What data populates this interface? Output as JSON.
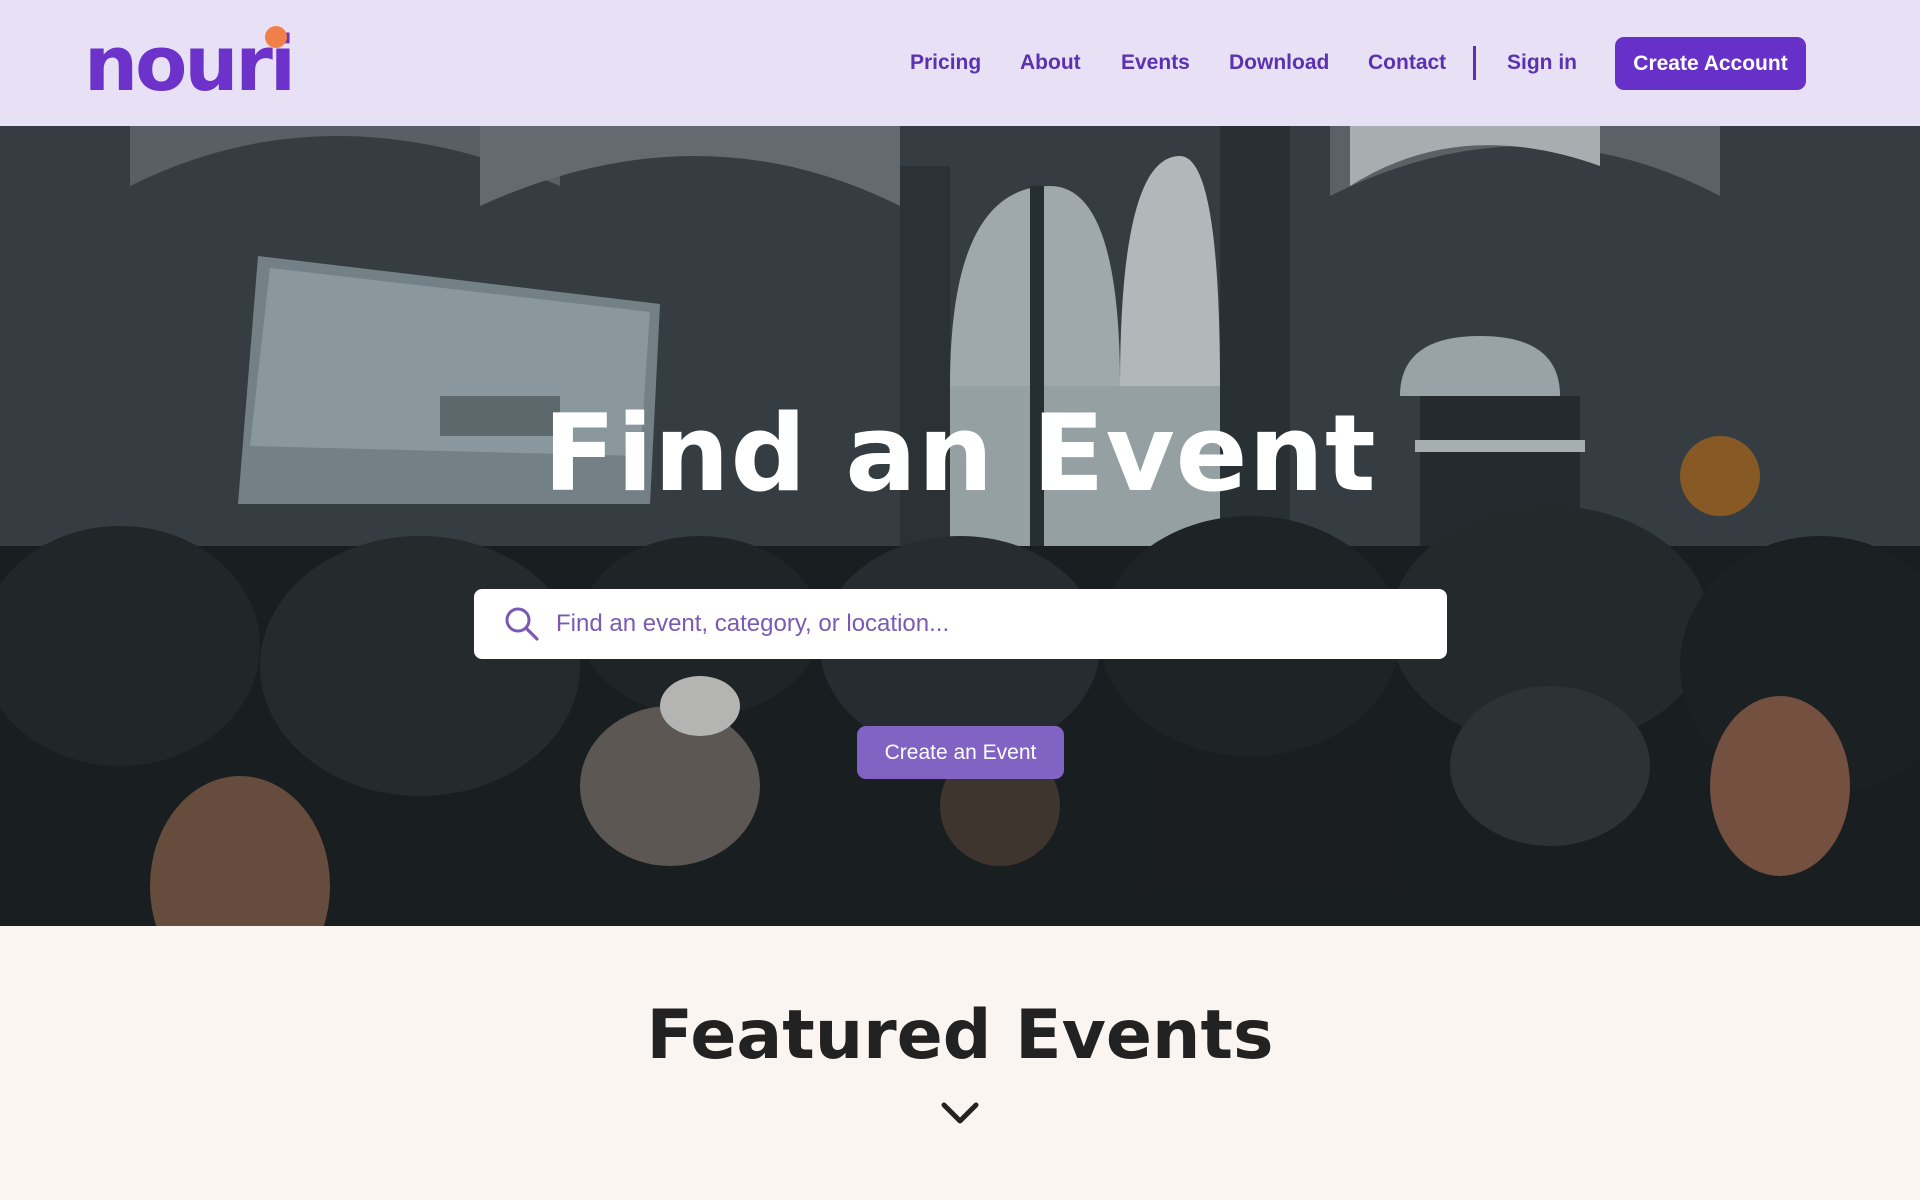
{
  "brand": {
    "name": "nouri",
    "accent": "#6630c9",
    "dot_color": "#f08048"
  },
  "nav": {
    "links": [
      "Pricing",
      "About",
      "Events",
      "Download",
      "Contact"
    ],
    "sign_in": "Sign in",
    "create_account": "Create Account"
  },
  "hero": {
    "title": "Find an Event",
    "search_placeholder": "Find an event, category, or location...",
    "search_icon": "search-icon",
    "create_event": "Create an Event"
  },
  "featured": {
    "title": "Featured Events",
    "icon": "chevron-down-icon"
  }
}
